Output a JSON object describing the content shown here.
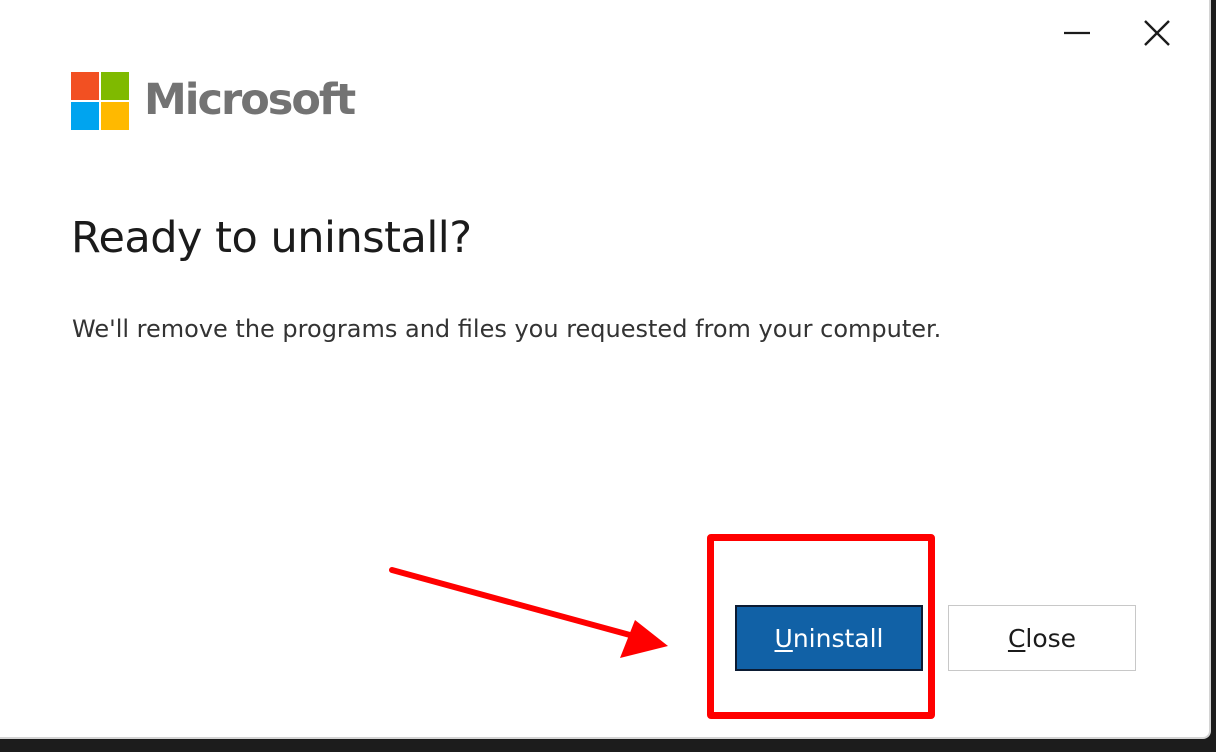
{
  "window": {
    "controls": {
      "minimize_icon": "minimize-icon",
      "close_icon": "close-icon"
    }
  },
  "brand": {
    "name": "Microsoft",
    "logo_colors": [
      "#f25022",
      "#7fba00",
      "#00a4ef",
      "#ffb900"
    ],
    "text_color": "#737373"
  },
  "dialog": {
    "heading": "Ready to uninstall?",
    "description": "We'll remove the programs and files you requested from your computer."
  },
  "buttons": {
    "uninstall": {
      "mnemonic": "U",
      "rest": "ninstall",
      "color": "#1161a6"
    },
    "close": {
      "mnemonic": "C",
      "rest": "lose"
    }
  },
  "annotation": {
    "highlight_color": "#ff0000",
    "arrow_color": "#ff0000"
  }
}
